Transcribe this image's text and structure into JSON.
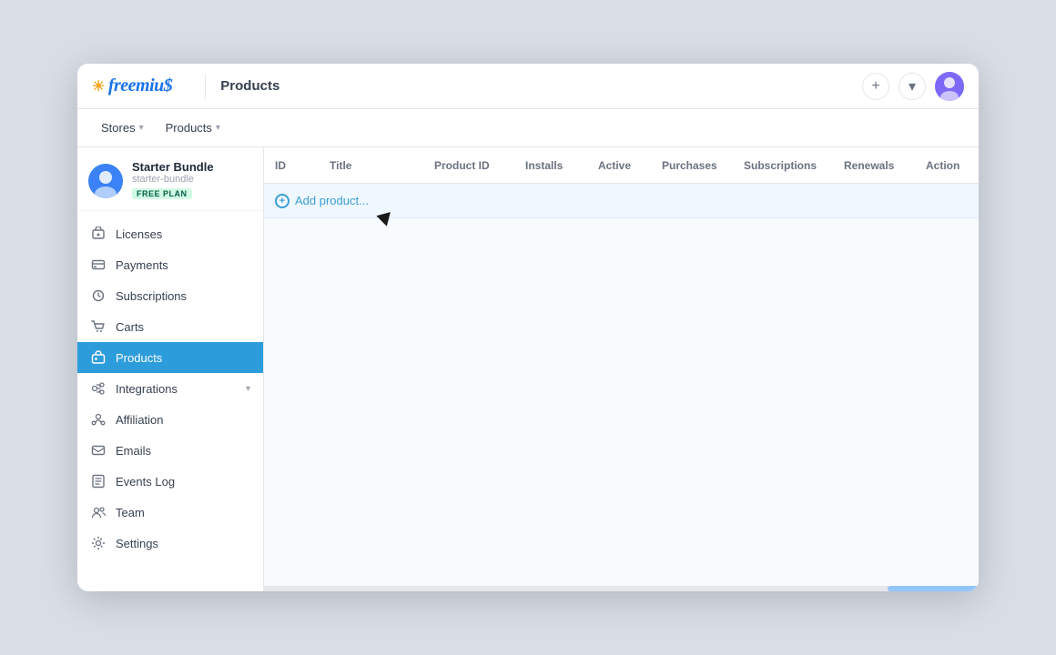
{
  "app": {
    "title": "Freemius"
  },
  "topbar": {
    "title": "Products",
    "sun_icon": "☀",
    "plus_icon": "+",
    "chevron_icon": "▾"
  },
  "secondary_nav": {
    "stores_label": "Stores",
    "products_label": "Products"
  },
  "store": {
    "name": "Starter Bundle",
    "slug": "starter-bundle",
    "plan": "FREE PLAN"
  },
  "sidebar_items": [
    {
      "id": "licenses",
      "label": "Licenses",
      "icon": "🔑"
    },
    {
      "id": "payments",
      "label": "Payments",
      "icon": "💳"
    },
    {
      "id": "subscriptions",
      "label": "Subscriptions",
      "icon": "🔄"
    },
    {
      "id": "carts",
      "label": "Carts",
      "icon": "🛒"
    },
    {
      "id": "products",
      "label": "Products",
      "icon": "📦",
      "active": true
    },
    {
      "id": "integrations",
      "label": "Integrations",
      "icon": "🔗",
      "has_chevron": true
    },
    {
      "id": "affiliation",
      "label": "Affiliation",
      "icon": "🤝"
    },
    {
      "id": "emails",
      "label": "Emails",
      "icon": "✉"
    },
    {
      "id": "events-log",
      "label": "Events Log",
      "icon": "📋"
    },
    {
      "id": "team",
      "label": "Team",
      "icon": "👥"
    },
    {
      "id": "settings",
      "label": "Settings",
      "icon": "⚙"
    }
  ],
  "table": {
    "columns": [
      {
        "id": "id",
        "label": "ID"
      },
      {
        "id": "title",
        "label": "Title"
      },
      {
        "id": "product_id",
        "label": "Product ID"
      },
      {
        "id": "installs",
        "label": "Installs"
      },
      {
        "id": "active",
        "label": "Active"
      },
      {
        "id": "purchases",
        "label": "Purchases"
      },
      {
        "id": "subscriptions",
        "label": "Subscriptions"
      },
      {
        "id": "renewals",
        "label": "Renewals"
      },
      {
        "id": "action",
        "label": "Action"
      }
    ],
    "add_product_label": "Add product..."
  },
  "colors": {
    "active_sidebar": "#2d9cdb",
    "brand_blue": "#1a73e8",
    "add_product_bg": "#eff8ff",
    "add_product_color": "#3b9dd6"
  }
}
